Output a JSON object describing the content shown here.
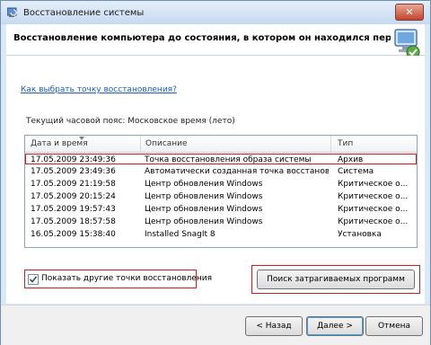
{
  "window": {
    "title": "Восстановление системы",
    "close_label": "✕"
  },
  "header": {
    "text": "Восстановление компьютера до состояния, в котором он находился перед выбранным собы"
  },
  "content": {
    "link": "Как выбрать точку восстановления?",
    "timezone": "Текущий часовой пояс: Московское время (лето)"
  },
  "table": {
    "headers": {
      "date": "Дата и время",
      "description": "Описание",
      "type": "Тип"
    },
    "rows": [
      {
        "date": "17.05.2009 23:49:36",
        "description": "Точка восстановления образа системы",
        "type": "Архив"
      },
      {
        "date": "17.05.2009 23:49:36",
        "description": "Автоматически созданная точка восстановле...",
        "type": "Система"
      },
      {
        "date": "17.05.2009 21:19:58",
        "description": "Центр обновления Windows",
        "type": "Критическое о..."
      },
      {
        "date": "17.05.2009 20:15:24",
        "description": "Центр обновления Windows",
        "type": "Критическое о..."
      },
      {
        "date": "17.05.2009 19:57:43",
        "description": "Центр обновления Windows",
        "type": "Критическое о..."
      },
      {
        "date": "17.05.2009 18:57:58",
        "description": "Центр обновления Windows",
        "type": "Критическое о..."
      },
      {
        "date": "16.05.2009 15:38:40",
        "description": "Installed SnagIt 8",
        "type": "Установка"
      }
    ]
  },
  "options": {
    "show_more_label": "Показать другие точки восстановления",
    "scan_button": "Поиск затрагиваемых программ"
  },
  "footer": {
    "back": "< Назад",
    "next": "Далее >",
    "cancel": "Отмена"
  }
}
